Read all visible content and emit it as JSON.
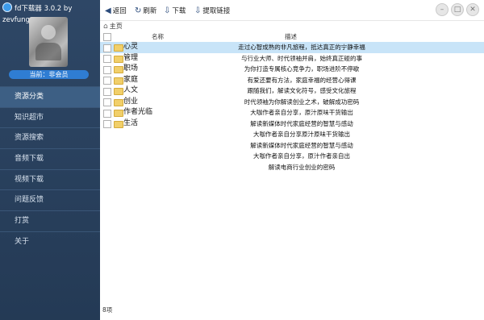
{
  "app": {
    "title": "fd下载器 3.0.2 by zevfung"
  },
  "user": {
    "badge": "当前：非会员"
  },
  "sidebar": {
    "items": [
      {
        "label": "资源分类",
        "active": true
      },
      {
        "label": "知识超市",
        "active": false
      },
      {
        "label": "资源搜索",
        "active": false
      },
      {
        "label": "音频下载",
        "active": false
      },
      {
        "label": "视频下载",
        "active": false
      },
      {
        "label": "问题反馈",
        "active": false
      },
      {
        "label": "打赏",
        "active": false
      },
      {
        "label": "关于",
        "active": false
      }
    ]
  },
  "toolbar": {
    "back": "返回",
    "refresh": "刷新",
    "download": "下载",
    "extract": "提取链接"
  },
  "breadcrumb": {
    "label": "主页"
  },
  "table": {
    "headers": {
      "name": "名称",
      "desc": "描述"
    },
    "rows": [
      {
        "name": "心灵",
        "desc": "走过心智成熟的非凡旅程，抵达真正的宁静幸福",
        "folder": true,
        "selected": true
      },
      {
        "name": "管理",
        "desc": "与行业大师、时代领袖并肩，始终真正碰的事",
        "folder": true,
        "selected": false
      },
      {
        "name": "职场",
        "desc": "为你打造专属核心竞争力，职场进阶不停歇",
        "folder": true,
        "selected": false
      },
      {
        "name": "家庭",
        "desc": "有爱还要有方法，家庭幸福的经营心得课",
        "folder": true,
        "selected": false
      },
      {
        "name": "人文",
        "desc": "跟随我们，解读文化符号，感受文化旅程",
        "folder": true,
        "selected": false
      },
      {
        "name": "创业",
        "desc": "时代领袖为你解读创业之术，破解成功密码",
        "folder": true,
        "selected": false
      },
      {
        "name": "作者光临",
        "desc": "大咖作者亲自分享，原汁原味干货输出",
        "folder": true,
        "selected": false
      },
      {
        "name": "生活",
        "desc": "解读新媒体时代家庭经营的智慧与感动",
        "folder": true,
        "selected": false
      },
      {
        "name": "",
        "desc": "大咖作者亲自分享原汁原味干货输出",
        "folder": false,
        "selected": false
      },
      {
        "name": "",
        "desc": "解读新媒体时代家庭经营的智慧与感动",
        "folder": false,
        "selected": false
      },
      {
        "name": "",
        "desc": "大咖作者亲自分享，原汁作者亲自出",
        "folder": false,
        "selected": false
      },
      {
        "name": "",
        "desc": "解读电商行业创业的密码",
        "folder": false,
        "selected": false
      }
    ]
  },
  "status": {
    "text": "8项"
  },
  "colors": {
    "sidebar_bg": "#2e4766",
    "accent": "#2f7dd3",
    "selected_row": "#c8e4f8",
    "folder": "#f1cf6a"
  },
  "icons": {
    "back": "arrow-left-icon",
    "refresh": "refresh-icon",
    "download": "download-icon",
    "extract": "download-link-icon",
    "min": "minimize-icon",
    "max": "maximize-icon",
    "close": "close-icon"
  }
}
